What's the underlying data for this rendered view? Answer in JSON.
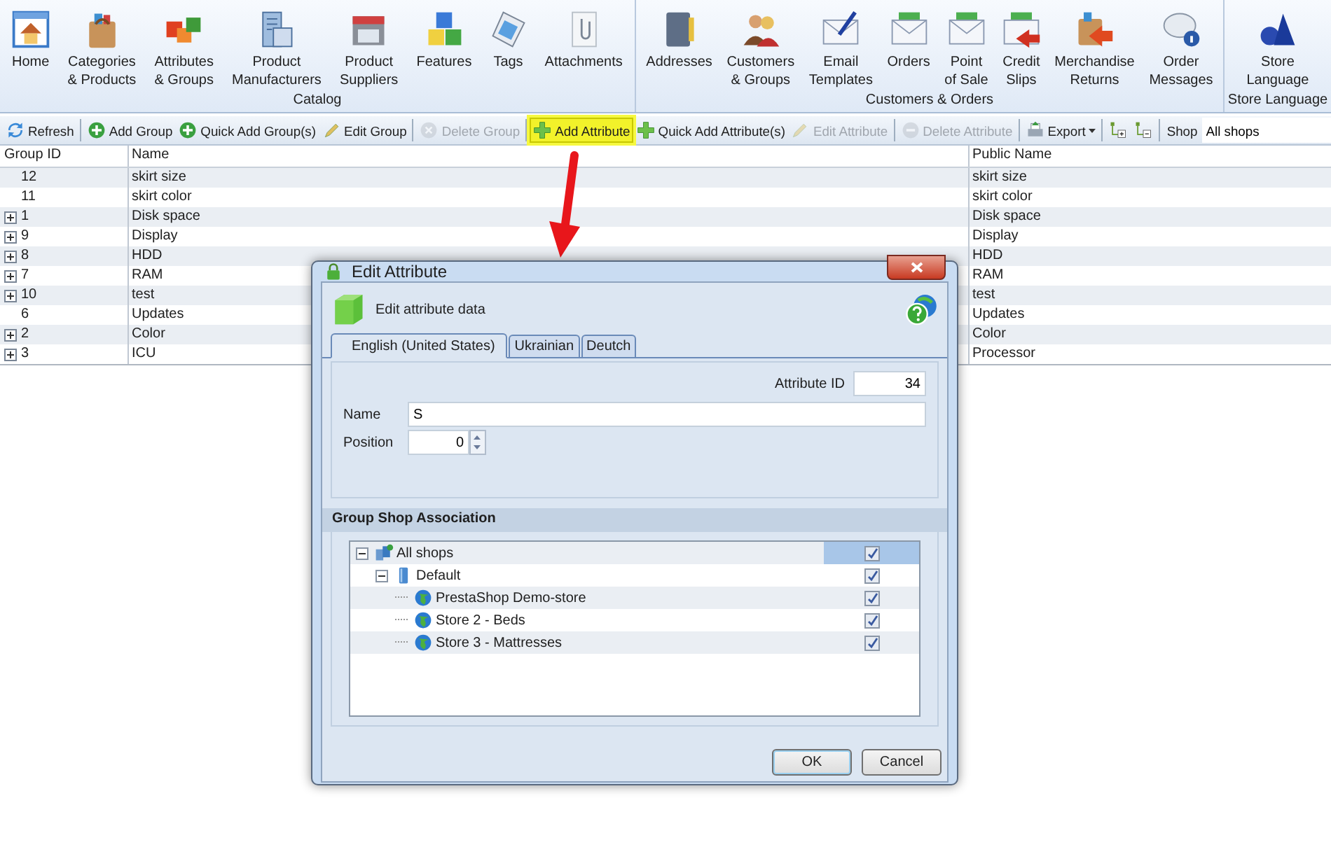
{
  "ribbon": {
    "groups": [
      {
        "label": "Catalog",
        "items": [
          {
            "label": "Home"
          },
          {
            "label": "Categories\n& Products"
          },
          {
            "label": "Attributes\n& Groups"
          },
          {
            "label": "Product\nManufacturers"
          },
          {
            "label": "Product\nSuppliers"
          },
          {
            "label": "Features"
          },
          {
            "label": "Tags"
          },
          {
            "label": "Attachments"
          }
        ]
      },
      {
        "label": "Customers & Orders",
        "items": [
          {
            "label": "Addresses"
          },
          {
            "label": "Customers\n& Groups"
          },
          {
            "label": "Email\nTemplates"
          },
          {
            "label": "Orders"
          },
          {
            "label": "Point\nof Sale"
          },
          {
            "label": "Credit\nSlips"
          },
          {
            "label": "Merchandise\nReturns"
          },
          {
            "label": "Order\nMessages"
          }
        ]
      },
      {
        "label": "Store Language",
        "items": [
          {
            "label": "Store\nLanguage"
          }
        ]
      }
    ]
  },
  "toolbar": {
    "groups": [
      [
        {
          "label": "Refresh",
          "disabled": false,
          "highlighted": false
        }
      ],
      [
        {
          "label": "Add Group",
          "disabled": false,
          "highlighted": false
        },
        {
          "label": "Quick Add Group(s)",
          "disabled": false,
          "highlighted": false
        },
        {
          "label": "Edit Group",
          "disabled": false,
          "highlighted": false
        }
      ],
      [
        {
          "label": "Delete Group",
          "disabled": true,
          "highlighted": false
        }
      ],
      [
        {
          "label": "Add Attribute",
          "disabled": false,
          "highlighted": true
        },
        {
          "label": "Quick Add Attribute(s)",
          "disabled": false,
          "highlighted": false
        },
        {
          "label": "Edit Attribute",
          "disabled": true,
          "highlighted": false
        }
      ],
      [
        {
          "label": "Delete Attribute",
          "disabled": true,
          "highlighted": false
        }
      ],
      [
        {
          "label": "Export",
          "disabled": false,
          "highlighted": false,
          "dropdown": true
        }
      ],
      [
        {
          "disabled": false,
          "highlighted": false
        },
        {
          "disabled": false,
          "highlighted": false
        }
      ]
    ],
    "shop_label": "Shop",
    "shop_value": "All shops"
  },
  "grid": {
    "columns": [
      "Group ID",
      "Name",
      "Public Name"
    ],
    "rows": [
      {
        "id": "12",
        "name": "skirt size",
        "public_name": "skirt size",
        "expandable": false
      },
      {
        "id": "11",
        "name": "skirt color",
        "public_name": "skirt color",
        "expandable": false
      },
      {
        "id": "1",
        "name": "Disk space",
        "public_name": "Disk space",
        "expandable": true
      },
      {
        "id": "9",
        "name": "Display",
        "public_name": "Display",
        "expandable": true
      },
      {
        "id": "8",
        "name": "HDD",
        "public_name": "HDD",
        "expandable": true
      },
      {
        "id": "7",
        "name": "RAM",
        "public_name": "RAM",
        "expandable": true
      },
      {
        "id": "10",
        "name": "test",
        "public_name": "test",
        "expandable": true
      },
      {
        "id": "6",
        "name": "Updates",
        "public_name": "Updates",
        "expandable": false
      },
      {
        "id": "2",
        "name": "Color",
        "public_name": "Color",
        "expandable": true
      },
      {
        "id": "3",
        "name": "ICU",
        "public_name": "Processor",
        "expandable": true
      }
    ]
  },
  "dialog": {
    "title": "Edit Attribute",
    "header": "Edit attribute data",
    "tabs": [
      {
        "label": "English (United States)",
        "selected": true
      },
      {
        "label": "Ukrainian",
        "selected": false
      },
      {
        "label": "Deutch",
        "selected": false
      }
    ],
    "attribute_id": {
      "label": "Attribute ID",
      "value": "34"
    },
    "name": {
      "label": "Name",
      "value": "S"
    },
    "position": {
      "label": "Position",
      "value": "0"
    },
    "section_title": "Group Shop Association",
    "tree": [
      {
        "label": "All shops",
        "checked": true,
        "selected": true,
        "expanded": true,
        "children": [
          {
            "label": "Default",
            "checked": true,
            "selected": false,
            "expanded": true,
            "children": [
              {
                "label": "PrestaShop Demo-store",
                "checked": true,
                "selected": false
              },
              {
                "label": "Store 2 - Beds",
                "checked": true,
                "selected": false
              },
              {
                "label": "Store 3 - Mattresses",
                "checked": true,
                "selected": false
              }
            ]
          }
        ]
      }
    ],
    "buttons": [
      {
        "label": "OK",
        "kind": "ok"
      },
      {
        "label": "Cancel",
        "kind": "cancel"
      }
    ]
  }
}
